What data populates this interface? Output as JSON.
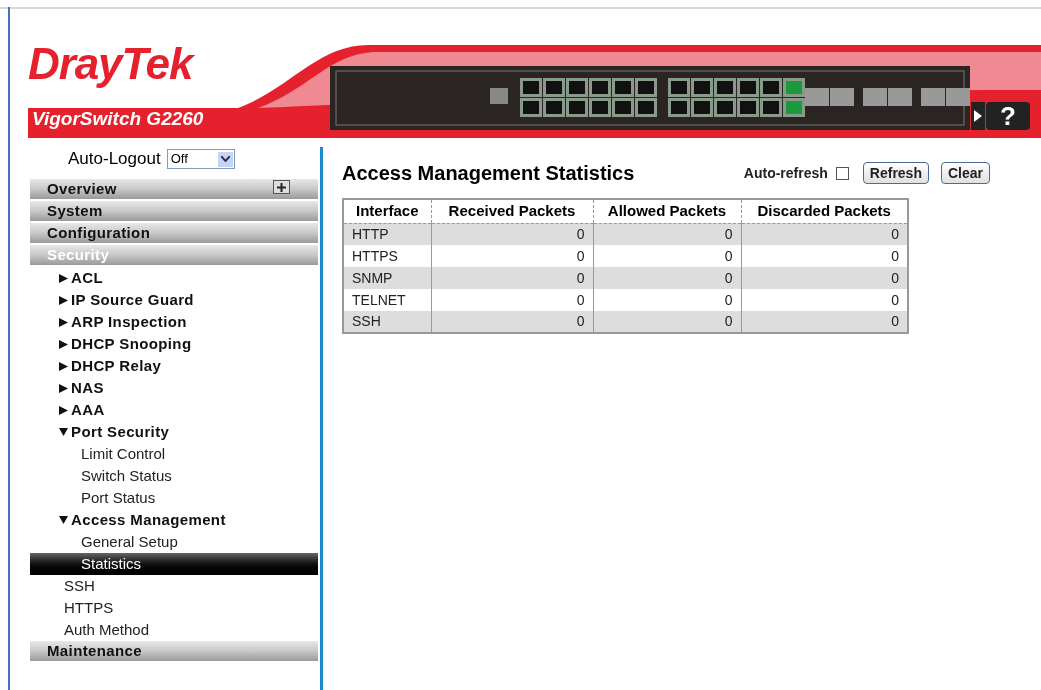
{
  "header": {
    "logo": "DrayTek",
    "model": "VigorSwitch G2260",
    "help_button": "?"
  },
  "sidebar": {
    "auto_logout": {
      "label": "Auto-Logout",
      "value": "Off"
    },
    "sections": [
      {
        "label": "Overview",
        "selected": false,
        "expanded": false
      },
      {
        "label": "System",
        "selected": false
      },
      {
        "label": "Configuration",
        "selected": false
      },
      {
        "label": "Security",
        "selected": true,
        "children": [
          {
            "label": "ACL",
            "kind": "group",
            "expanded": false,
            "selected": false
          },
          {
            "label": "IP Source Guard",
            "kind": "group",
            "expanded": false,
            "selected": false
          },
          {
            "label": "ARP Inspection",
            "kind": "group",
            "expanded": false,
            "selected": false
          },
          {
            "label": "DHCP Snooping",
            "kind": "group",
            "expanded": false,
            "selected": false
          },
          {
            "label": "DHCP Relay",
            "kind": "group",
            "expanded": false,
            "selected": false
          },
          {
            "label": "NAS",
            "kind": "group",
            "expanded": false,
            "selected": false
          },
          {
            "label": "AAA",
            "kind": "group",
            "expanded": false,
            "selected": false
          },
          {
            "label": "Port Security",
            "kind": "group",
            "expanded": true,
            "selected": false,
            "children": [
              {
                "label": "Limit Control",
                "selected": false
              },
              {
                "label": "Switch Status",
                "selected": false
              },
              {
                "label": "Port Status",
                "selected": false
              }
            ]
          },
          {
            "label": "Access Management",
            "kind": "group",
            "expanded": true,
            "selected": false,
            "children": [
              {
                "label": "General Setup",
                "selected": false
              },
              {
                "label": "Statistics",
                "selected": true
              }
            ]
          },
          {
            "label": "SSH",
            "kind": "leaf",
            "selected": false
          },
          {
            "label": "HTTPS",
            "kind": "leaf",
            "selected": false
          },
          {
            "label": "Auth Method",
            "kind": "leaf",
            "selected": false
          }
        ]
      },
      {
        "label": "Maintenance",
        "selected": false
      }
    ]
  },
  "content": {
    "title": "Access Management Statistics",
    "auto_refresh": {
      "label": "Auto-refresh",
      "checked": false
    },
    "buttons": [
      "Refresh",
      "Clear"
    ],
    "table": {
      "columns": [
        "Interface",
        "Received Packets",
        "Allowed Packets",
        "Discarded Packets"
      ],
      "rows": [
        [
          "HTTP",
          "0",
          "0",
          "0"
        ],
        [
          "HTTPS",
          "0",
          "0",
          "0"
        ],
        [
          "SNMP",
          "0",
          "0",
          "0"
        ],
        [
          "TELNET",
          "0",
          "0",
          "0"
        ],
        [
          "SSH",
          "0",
          "0",
          "0"
        ]
      ]
    }
  }
}
